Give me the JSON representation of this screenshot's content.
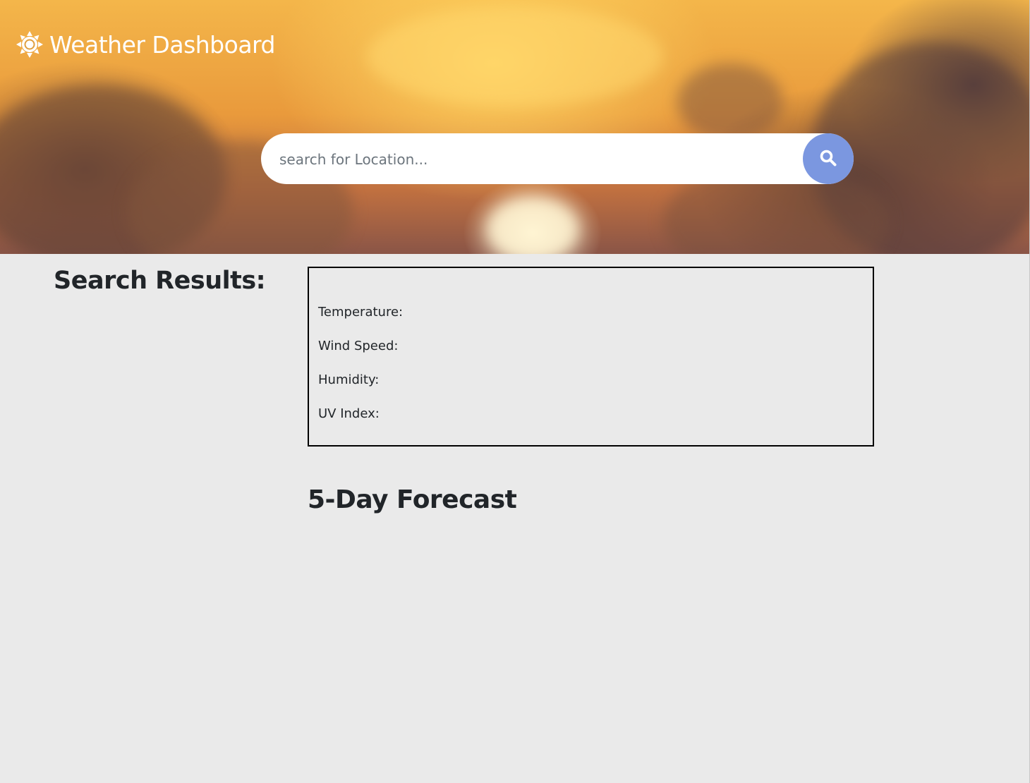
{
  "header": {
    "title": "Weather Dashboard",
    "logo_icon": "sun-icon"
  },
  "search": {
    "placeholder": "search for Location...",
    "value": "",
    "button_icon": "search-icon",
    "button_color": "#7b97e0"
  },
  "results": {
    "heading": "Search Results:"
  },
  "current": {
    "temperature_label": "Temperature:",
    "wind_label": "Wind Speed:",
    "humidity_label": "Humidity:",
    "uv_label": "UV Index:"
  },
  "forecast": {
    "heading": "5-Day Forecast"
  },
  "colors": {
    "page_background": "#eaeaea",
    "text": "#212529",
    "box_border": "#000000"
  }
}
